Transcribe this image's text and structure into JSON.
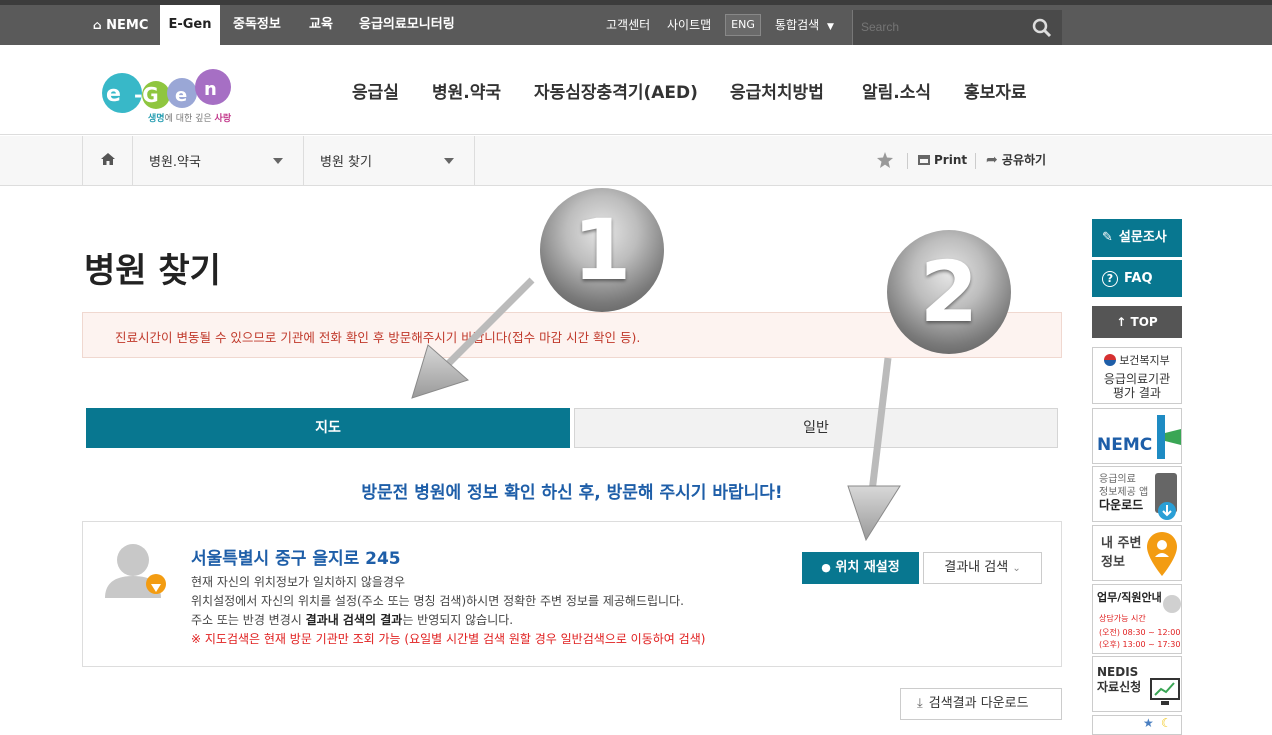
{
  "topbar": {
    "items": [
      "NEMC",
      "E-Gen",
      "중독정보",
      "교육",
      "응급의료모니터링"
    ],
    "right": [
      "고객센터",
      "사이트맵"
    ],
    "eng": "ENG",
    "search_label": "통합검색",
    "search_placeholder": "Search"
  },
  "logo": {
    "word": "e-Gen",
    "tagline_prefix": "생명",
    "tagline_mid": "에 대한 깊은 ",
    "tagline_suffix": "사랑"
  },
  "gnb": [
    "응급실",
    "병원.약국",
    "자동심장충격기(AED)",
    "응급처치방법",
    "알림.소식",
    "홍보자료"
  ],
  "location": {
    "depth1": "병원.약국",
    "depth2": "병원 찾기",
    "print": "Print",
    "share": "공유하기"
  },
  "page_title": "병원 찾기",
  "notice": "진료시간이 변동될 수 있으므로 기관에 전화 확인 후 방문해주시기 바랍니다(접수 마감 시간 확인 등).",
  "tabs": {
    "map": "지도",
    "normal": "일반"
  },
  "headline": "방문전 병원에 정보 확인 하신 후, 방문해 주시기 바랍니다!",
  "location_box": {
    "address": "서울특별시 중구 을지로 245",
    "line1": "현재 자신의 위치정보가 일치하지 않을경우",
    "line2": "위치설정에서 자신의 위치를 설정(주소 또는 명칭 검색)하시면 정확한 주변 정보를 제공해드립니다.",
    "line3_a": "주소 또는 반경 변경시 ",
    "line3_b": "결과내 검색의 결과",
    "line3_c": "는 반영되지 않습니다.",
    "line4": "※ 지도검색은 현재 방문 기관만 조회 가능 (요일별 시간별 검색 원할 경우 일반검색으로 이동하여 검색)",
    "btn_reset": "위치 재설정",
    "btn_search": "결과내 검색"
  },
  "download": "검색결과 다운로드",
  "quick": {
    "survey": "설문조사",
    "faq": "FAQ",
    "top": "TOP",
    "eval_org": "보건복지부",
    "eval_title": "응급의료기관 평가 결과",
    "nemc": "NEMC",
    "app_line1": "응급의료",
    "app_line2": "정보제공 앱",
    "app_line3": "다운로드",
    "near_line1": "내 주변",
    "near_line2": "정보",
    "staff_title": "업무/직원안내",
    "staff_hours": "상담가능 시간",
    "staff_time1": "(오전) 08:30 ~ 12:00",
    "staff_time2": "(오후) 13:00 ~ 17:30",
    "nedis_line1": "NEDIS",
    "nedis_line2": "자료신청"
  },
  "annotations": {
    "one": "1",
    "two": "2"
  }
}
